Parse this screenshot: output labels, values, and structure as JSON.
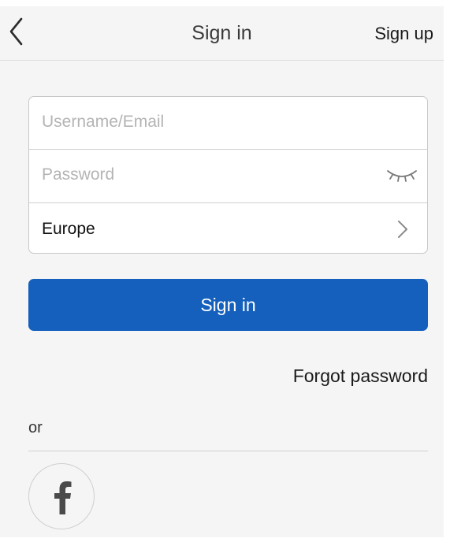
{
  "nav": {
    "back_icon": "chevron-left-icon",
    "title": "Sign in",
    "signup_label": "Sign up"
  },
  "form": {
    "username_placeholder": "Username/Email",
    "username_value": "",
    "password_placeholder": "Password",
    "password_value": "",
    "password_toggle_icon": "eye-closed-icon",
    "region_value": "Europe",
    "region_icon": "chevron-right-icon"
  },
  "actions": {
    "signin_label": "Sign in",
    "signin_color": "#1560bd",
    "forgot_label": "Forgot password"
  },
  "social": {
    "or_label": "or",
    "facebook_icon": "facebook-icon"
  }
}
